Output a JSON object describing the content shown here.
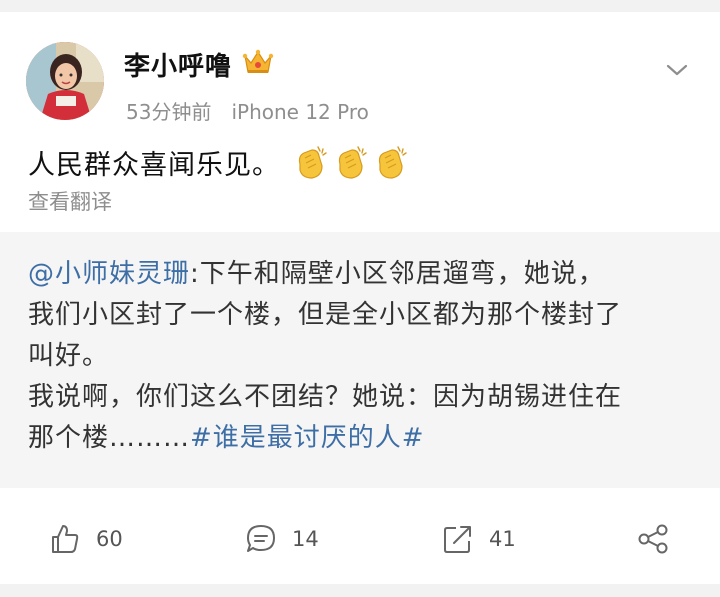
{
  "post": {
    "username": "李小呼噜",
    "time": "53分钟前",
    "device": "iPhone 12 Pro",
    "text": "人民群众喜闻乐见。",
    "emoji": [
      "clapping-hands",
      "clapping-hands",
      "clapping-hands"
    ],
    "translate_label": "查看翻译"
  },
  "repost": {
    "mention": "@小师妹灵珊",
    "line1_rest": ":下午和隔壁小区邻居遛弯，她说，",
    "line2": "我们小区封了一个楼，但是全小区都为那个楼封了",
    "line3": "叫好。",
    "line4": "我说啊，你们这么不团结？她说：因为胡锡进住在",
    "line5_prefix": "那个楼………",
    "hashtag": "#谁是最讨厌的人#"
  },
  "actions": {
    "likes": "60",
    "comments": "14",
    "reposts": "41"
  },
  "colors": {
    "link": "#3e6ea6",
    "muted": "#8e8e8e",
    "repost_bg": "#f5f5f5"
  }
}
